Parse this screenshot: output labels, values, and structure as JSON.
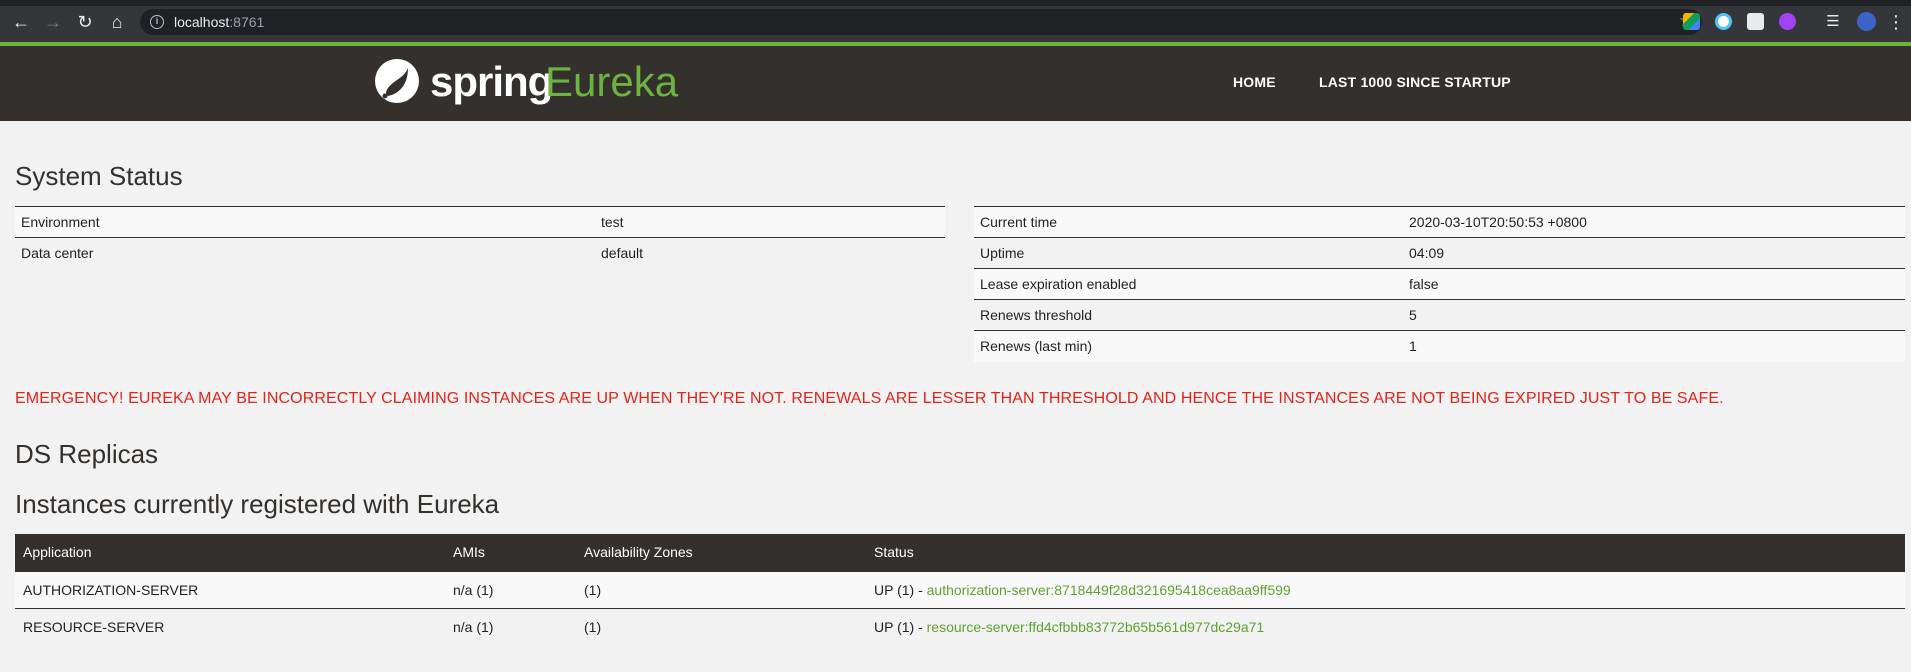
{
  "browser": {
    "url_host": "localhost",
    "url_port": ":8761"
  },
  "header": {
    "logo_spring": "spring",
    "logo_eureka": "Eureka",
    "nav": [
      "HOME",
      "LAST 1000 SINCE STARTUP"
    ]
  },
  "system_status": {
    "title": "System Status",
    "left": [
      {
        "label": "Environment",
        "value": "test"
      },
      {
        "label": "Data center",
        "value": "default"
      }
    ],
    "right": [
      {
        "label": "Current time",
        "value": "2020-03-10T20:50:53 +0800"
      },
      {
        "label": "Uptime",
        "value": "04:09"
      },
      {
        "label": "Lease expiration enabled",
        "value": "false"
      },
      {
        "label": "Renews threshold",
        "value": "5"
      },
      {
        "label": "Renews (last min)",
        "value": "1"
      }
    ]
  },
  "emergency": "EMERGENCY! EUREKA MAY BE INCORRECTLY CLAIMING INSTANCES ARE UP WHEN THEY'RE NOT. RENEWALS ARE LESSER THAN THRESHOLD AND HENCE THE INSTANCES ARE NOT BEING EXPIRED JUST TO BE SAFE.",
  "ds_replicas": {
    "title": "DS Replicas"
  },
  "instances": {
    "title": "Instances currently registered with Eureka",
    "columns": [
      "Application",
      "AMIs",
      "Availability Zones",
      "Status"
    ],
    "rows": [
      {
        "application": "AUTHORIZATION-SERVER",
        "amis": "n/a (1)",
        "zones": "(1)",
        "status_prefix": "UP (1) - ",
        "instance_link": "authorization-server:8718449f28d321695418cea8aa9ff599"
      },
      {
        "application": "RESOURCE-SERVER",
        "amis": "n/a (1)",
        "zones": "(1)",
        "status_prefix": "UP (1) - ",
        "instance_link": "resource-server:ffd4cfbbb83772b65b561d977dc29a71"
      }
    ]
  },
  "colors": {
    "accent_green": "#6db33f",
    "header_bg": "#34302d",
    "emergency_red": "#e2231a"
  }
}
